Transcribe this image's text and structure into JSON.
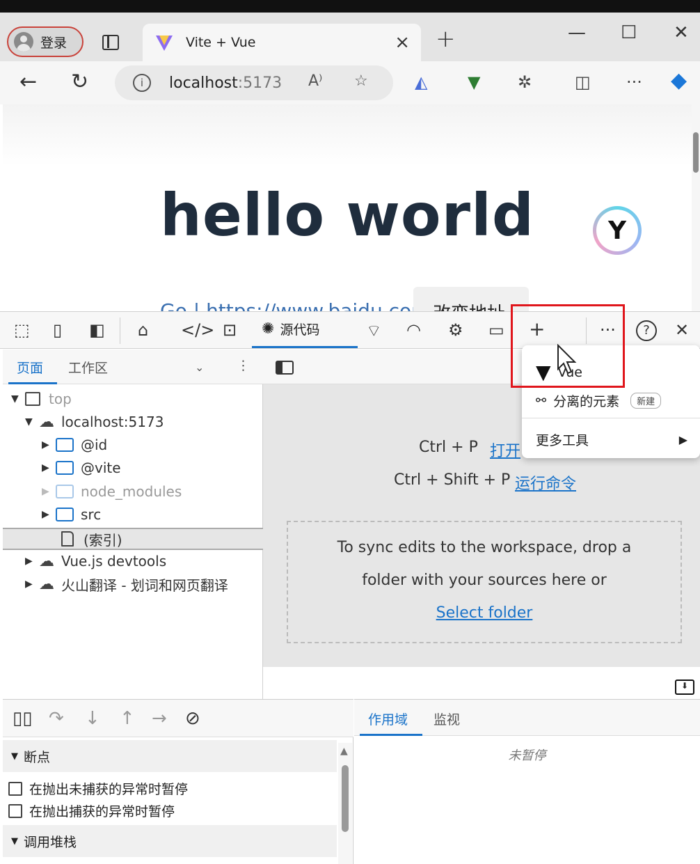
{
  "browser": {
    "login_label": "登录",
    "tab_title": "Vite + Vue",
    "url_host": "localhost",
    "url_port": ":5173",
    "close_tab": "×",
    "new_tab": "+",
    "window_min": "—",
    "window_max": "☐",
    "window_close": "✕"
  },
  "page": {
    "heading": "hello world",
    "link_text": "Go | https://www.baidu.com",
    "button_label": "改变地址"
  },
  "devtools": {
    "sources_tab": "源代码",
    "navigator": {
      "tab_page": "页面",
      "tab_workspace": "工作区",
      "tree": {
        "top": "top",
        "host": "localhost:5173",
        "id": "@id",
        "vite": "@vite",
        "node_modules": "node_modules",
        "src": "src",
        "index": "(索引)",
        "vue_devtools": "Vue.js devtools",
        "volc_translate": "火山翻译 - 划词和网页翻译"
      }
    },
    "editor": {
      "shortcut1_keys": "Ctrl + P",
      "shortcut1_action": "打开",
      "shortcut2_keys": "Ctrl + Shift + P",
      "shortcut2_action": "运行命令",
      "drop_line1": "To sync edits to the workspace, drop a",
      "drop_line2": "folder with your sources here or",
      "select_folder": "Select folder"
    },
    "menu": {
      "vue": "Vue",
      "detached": "分离的元素",
      "new_badge": "新建",
      "more_tools": "更多工具"
    },
    "debugger": {
      "breakpoints": "断点",
      "pause_uncaught": "在抛出未捕获的异常时暂停",
      "pause_caught": "在抛出捕获的异常时暂停",
      "call_stack": "调用堆栈"
    },
    "scope": {
      "tab_scope": "作用域",
      "tab_watch": "监视",
      "not_paused": "未暂停"
    }
  },
  "colors": {
    "accent": "#1a73c9",
    "highlight_box": "#e0161c",
    "heading": "#1f2d3d"
  }
}
